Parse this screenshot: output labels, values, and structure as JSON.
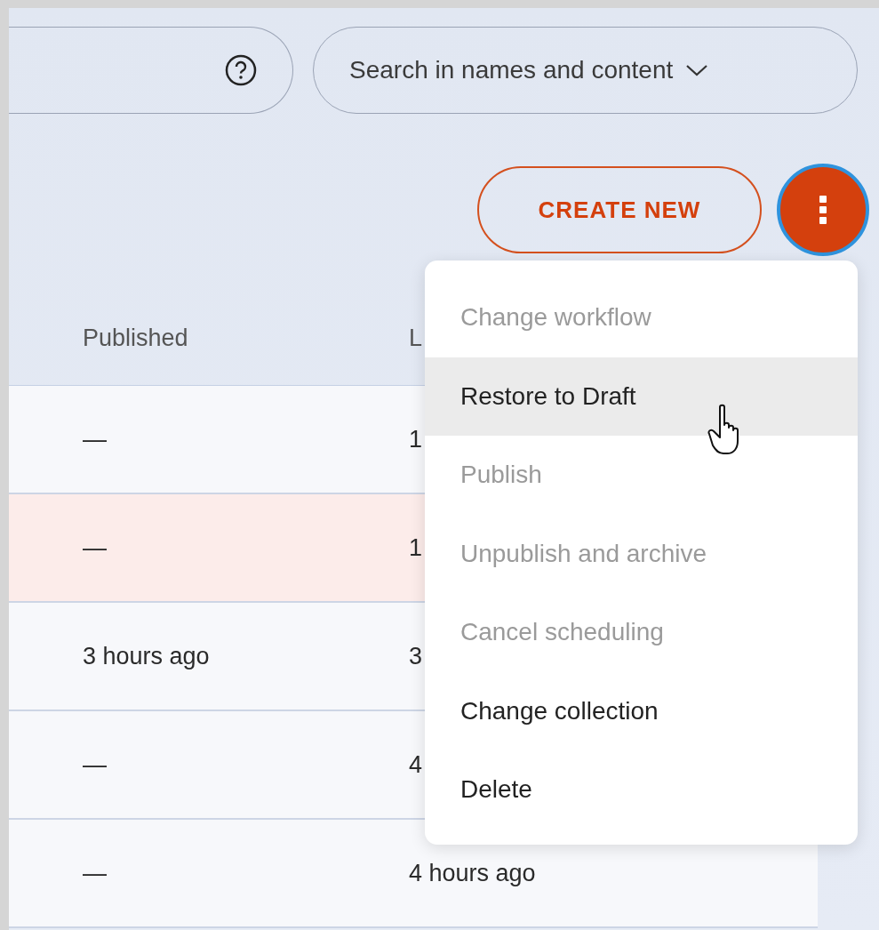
{
  "scope_dropdown": {
    "label": "Search in names and content"
  },
  "create_button": {
    "label": "CREATE NEW"
  },
  "more_button": {
    "focused": true
  },
  "table": {
    "columns": [
      "Published",
      "L"
    ],
    "rows": [
      {
        "cells": [
          "—",
          "1"
        ],
        "highlighted": false
      },
      {
        "cells": [
          "—",
          "1"
        ],
        "highlighted": true
      },
      {
        "cells": [
          "3 hours ago",
          "3"
        ],
        "highlighted": false
      },
      {
        "cells": [
          "—",
          "4"
        ],
        "highlighted": false
      },
      {
        "cells": [
          "—",
          "4 hours ago"
        ],
        "highlighted": false
      }
    ]
  },
  "menu": {
    "items": [
      {
        "label": "Change workflow",
        "disabled": true,
        "hovered": false
      },
      {
        "label": "Restore to Draft",
        "disabled": false,
        "hovered": true
      },
      {
        "label": "Publish",
        "disabled": true,
        "hovered": false
      },
      {
        "label": "Unpublish and archive",
        "disabled": true,
        "hovered": false
      },
      {
        "label": "Cancel scheduling",
        "disabled": true,
        "hovered": false
      },
      {
        "label": "Change collection",
        "disabled": false,
        "hovered": false
      },
      {
        "label": "Delete",
        "disabled": false,
        "hovered": false
      }
    ]
  }
}
